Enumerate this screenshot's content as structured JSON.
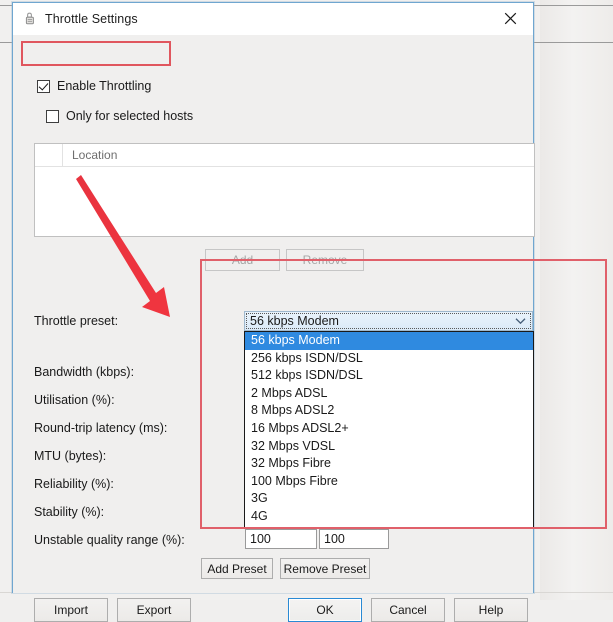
{
  "window": {
    "title": "Throttle Settings",
    "icon": "throttle-app-icon",
    "close_label": "✕"
  },
  "checkboxes": {
    "enable_throttling": {
      "label": "Enable Throttling",
      "checked": true
    },
    "only_selected_hosts": {
      "label": "Only for selected hosts",
      "checked": false
    }
  },
  "hosts_list": {
    "columns": [
      "",
      "Location"
    ],
    "rows": []
  },
  "list_buttons": {
    "add": "Add",
    "remove": "Remove"
  },
  "fields": {
    "throttle_preset": "Throttle preset:",
    "bandwidth": "Bandwidth (kbps):",
    "utilisation": "Utilisation (%):",
    "round_trip_latency": "Round-trip latency (ms):",
    "mtu": "MTU (bytes):",
    "reliability": "Reliability (%):",
    "stability": "Stability (%):",
    "unstable_quality_range": "Unstable quality range (%):"
  },
  "preset_combo": {
    "selected": "56 kbps Modem",
    "expanded": true,
    "options": [
      "56 kbps Modem",
      "256 kbps ISDN/DSL",
      "512 kbps ISDN/DSL",
      "2 Mbps ADSL",
      "8 Mbps ADSL2",
      "16 Mbps ADSL2+",
      "32 Mbps VDSL",
      "32 Mbps Fibre",
      "100 Mbps Fibre",
      "3G",
      "4G"
    ]
  },
  "quality_range": {
    "min": "100",
    "max": "100"
  },
  "preset_buttons": {
    "add_preset": "Add Preset",
    "remove_preset": "Remove Preset"
  },
  "dialog_buttons": {
    "import": "Import",
    "export": "Export",
    "ok": "OK",
    "cancel": "Cancel",
    "help": "Help"
  },
  "annotations": {
    "highlight_enable": "red-rectangle-around-enable-throttling",
    "highlight_preset": "red-rectangle-around-preset-section",
    "arrow": "red-arrow-pointing-to-throttle-preset"
  },
  "colors": {
    "annotation_red": "#e0565e",
    "selection_blue": "#2f8ae0",
    "window_border": "#6fa6d0"
  }
}
